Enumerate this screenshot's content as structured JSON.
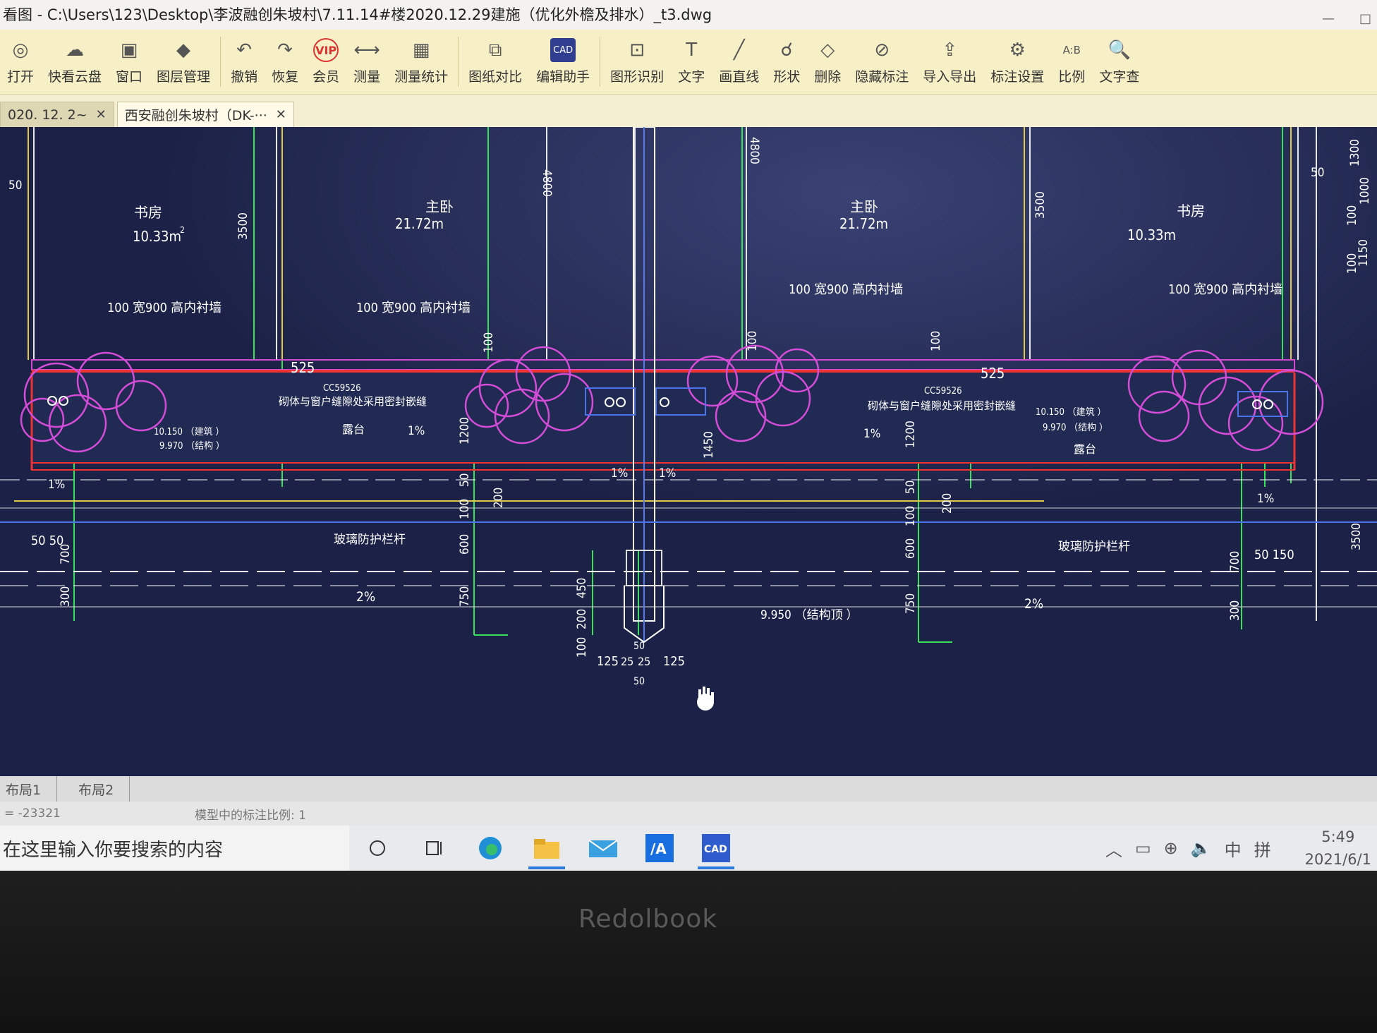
{
  "window": {
    "title": "看图 - C:\\Users\\123\\Desktop\\李波融创朱坡村\\7.11.14#楼2020.12.29建施（优化外檐及排水）_t3.dwg",
    "min_label": "—",
    "close_label": "□"
  },
  "toolbar": {
    "items": [
      {
        "label": "打开",
        "icon": "folder-open-icon",
        "glyph": "◎"
      },
      {
        "label": "快看云盘",
        "icon": "cloud-icon",
        "glyph": "☁"
      },
      {
        "label": "窗口",
        "icon": "window-icon",
        "glyph": "▣"
      },
      {
        "label": "图层管理",
        "icon": "layers-icon",
        "glyph": "◆"
      },
      {
        "label": "撤销",
        "icon": "undo-icon",
        "glyph": "↶"
      },
      {
        "label": "恢复",
        "icon": "redo-icon",
        "glyph": "↷"
      },
      {
        "label": "会员",
        "icon": "vip-icon",
        "glyph": "VIP"
      },
      {
        "label": "测量",
        "icon": "measure-icon",
        "glyph": "⟷"
      },
      {
        "label": "测量统计",
        "icon": "measure-stats-icon",
        "glyph": "▦"
      },
      {
        "label": "图纸对比",
        "icon": "compare-icon",
        "glyph": "⧉"
      },
      {
        "label": "编辑助手",
        "icon": "edit-assistant-icon",
        "glyph": "CAD"
      },
      {
        "label": "图形识别",
        "icon": "shape-recognize-icon",
        "glyph": "⊡"
      },
      {
        "label": "文字",
        "icon": "text-icon",
        "glyph": "T"
      },
      {
        "label": "画直线",
        "icon": "line-icon",
        "glyph": "╱"
      },
      {
        "label": "形状",
        "icon": "shape-icon",
        "glyph": "☌"
      },
      {
        "label": "删除",
        "icon": "eraser-icon",
        "glyph": "◇"
      },
      {
        "label": "隐藏标注",
        "icon": "hide-annotation-icon",
        "glyph": "⊘"
      },
      {
        "label": "导入导出",
        "icon": "import-export-icon",
        "glyph": "⇪"
      },
      {
        "label": "标注设置",
        "icon": "annotation-settings-icon",
        "glyph": "⚙"
      },
      {
        "label": "比例",
        "icon": "scale-icon",
        "glyph": "A:B"
      },
      {
        "label": "文字查",
        "icon": "text-search-icon",
        "glyph": "🔍"
      }
    ]
  },
  "tabs": [
    {
      "label": "020. 12. 2~",
      "close": "✕",
      "active": false
    },
    {
      "label": "西安融创朱坡村（DK-···",
      "close": "✕",
      "active": true
    }
  ],
  "drawing": {
    "labels": {
      "room_study_l": "书房",
      "area_study_l": "10.33m",
      "room_master_l": "主卧",
      "area_master_l": "21.72m",
      "room_master_r": "主卧",
      "area_master_r": "21.72m",
      "room_study_r": "书房",
      "area_study_r": "10.33m",
      "sq": "2",
      "wall_note_1": "100  宽900  高内衬墙",
      "wall_note_2": "100  宽900  高内衬墙",
      "wall_note_3": "100  宽900  高内衬墙",
      "wall_note_4": "100  宽900  高内衬墙",
      "ref_l": "CC59526",
      "ref_r": "CC59526",
      "detail_l": "砌体与窗户缝隙处采用密封嵌缝",
      "detail_r": "砌体与窗户缝隙处采用密封嵌缝",
      "lvl_l1": "10.150  （建筑  ）",
      "lvl_l2": "9.970  （结构  ）",
      "lvl_r1": "10.150  （建筑  ）",
      "lvl_r2": "9.970  （结构  ）",
      "lvl_bottom": "9.950  （结构顶      ）",
      "rail_l": "玻璃防护栏杆",
      "rail_r": "玻璃防护栏杆",
      "planter_l": "露台",
      "planter_r": "露台",
      "pct1": "1%",
      "pct2": "2%"
    },
    "dims": {
      "d50": "50",
      "d3500": "3500",
      "d4800": "4800",
      "d100": "100",
      "d525": "525",
      "d1200": "1200",
      "d1450": "1450",
      "d200": "200",
      "d600": "600",
      "d750": "750",
      "d700": "700",
      "d300": "300",
      "d1300": "1300",
      "d1000": "1000",
      "d1150": "1150",
      "d150": "150",
      "d125": "125",
      "d25": "25",
      "d450": "450",
      "d5050": "50 50",
      "d50150": "50  150"
    }
  },
  "layout_tabs": [
    "布局1",
    "布局2"
  ],
  "status": {
    "coord": "= -23321",
    "scale_note": "模型中的标注比例: 1"
  },
  "taskbar": {
    "search_placeholder": "在这里输入你要搜索的内容",
    "time": "5:49",
    "date": "2021/6/1",
    "ime_lang": "中",
    "ime_mode": "拼"
  },
  "device": {
    "brand": "Redolbook"
  }
}
